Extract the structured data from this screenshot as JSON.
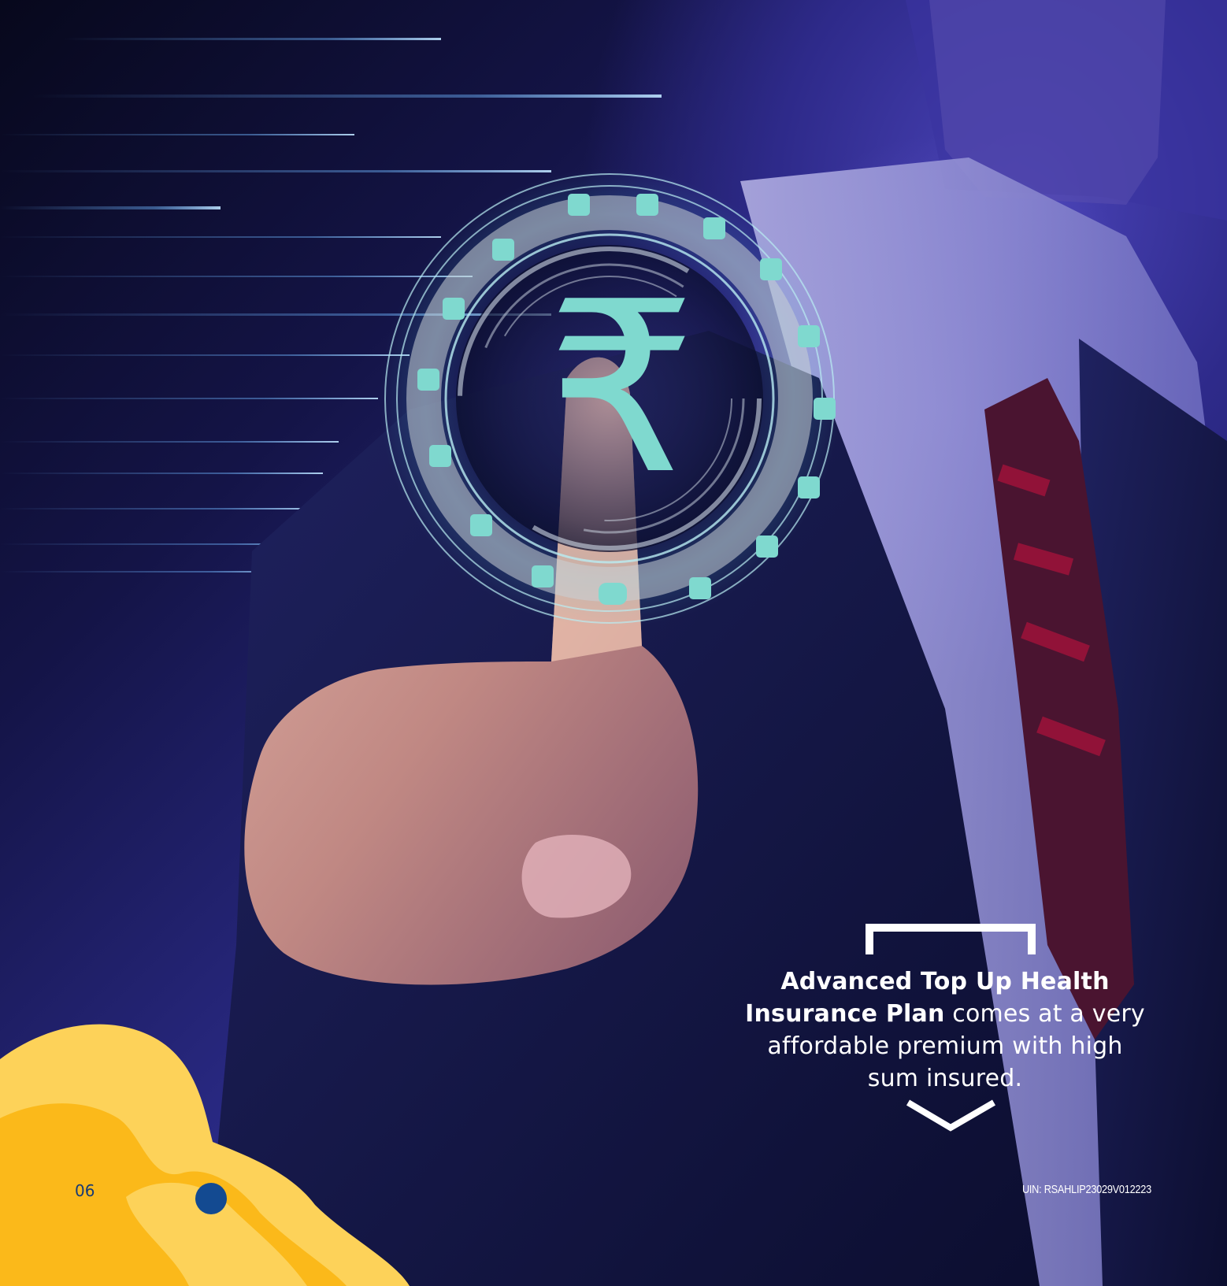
{
  "caption": {
    "bold": "Advanced Top Up Health Insurance Plan",
    "rest": " comes at a very affordable premium with high sum insured."
  },
  "footer": {
    "page_number": "06",
    "uin": "UIN: RSAHLIP23029V012223"
  },
  "hologram": {
    "center_symbol": "₹",
    "ring_icons": [
      "document-icon",
      "mail-icon",
      "percent-icon",
      "gear-icon",
      "diamond-icon",
      "percent-icon",
      "clock-icon",
      "search-icon",
      "globe-icon",
      "cloud-icon",
      "calculator-icon",
      "at-icon",
      "chat-icon",
      "magnifier-icon",
      "bulb-icon",
      "home-icon"
    ]
  },
  "colors": {
    "accent_teal": "#7fd9cf",
    "blob_yellow": "#fdd259",
    "blob_orange": "#fbb91a",
    "dot_blue": "#134a91",
    "background_blue": "#2b2a84"
  }
}
